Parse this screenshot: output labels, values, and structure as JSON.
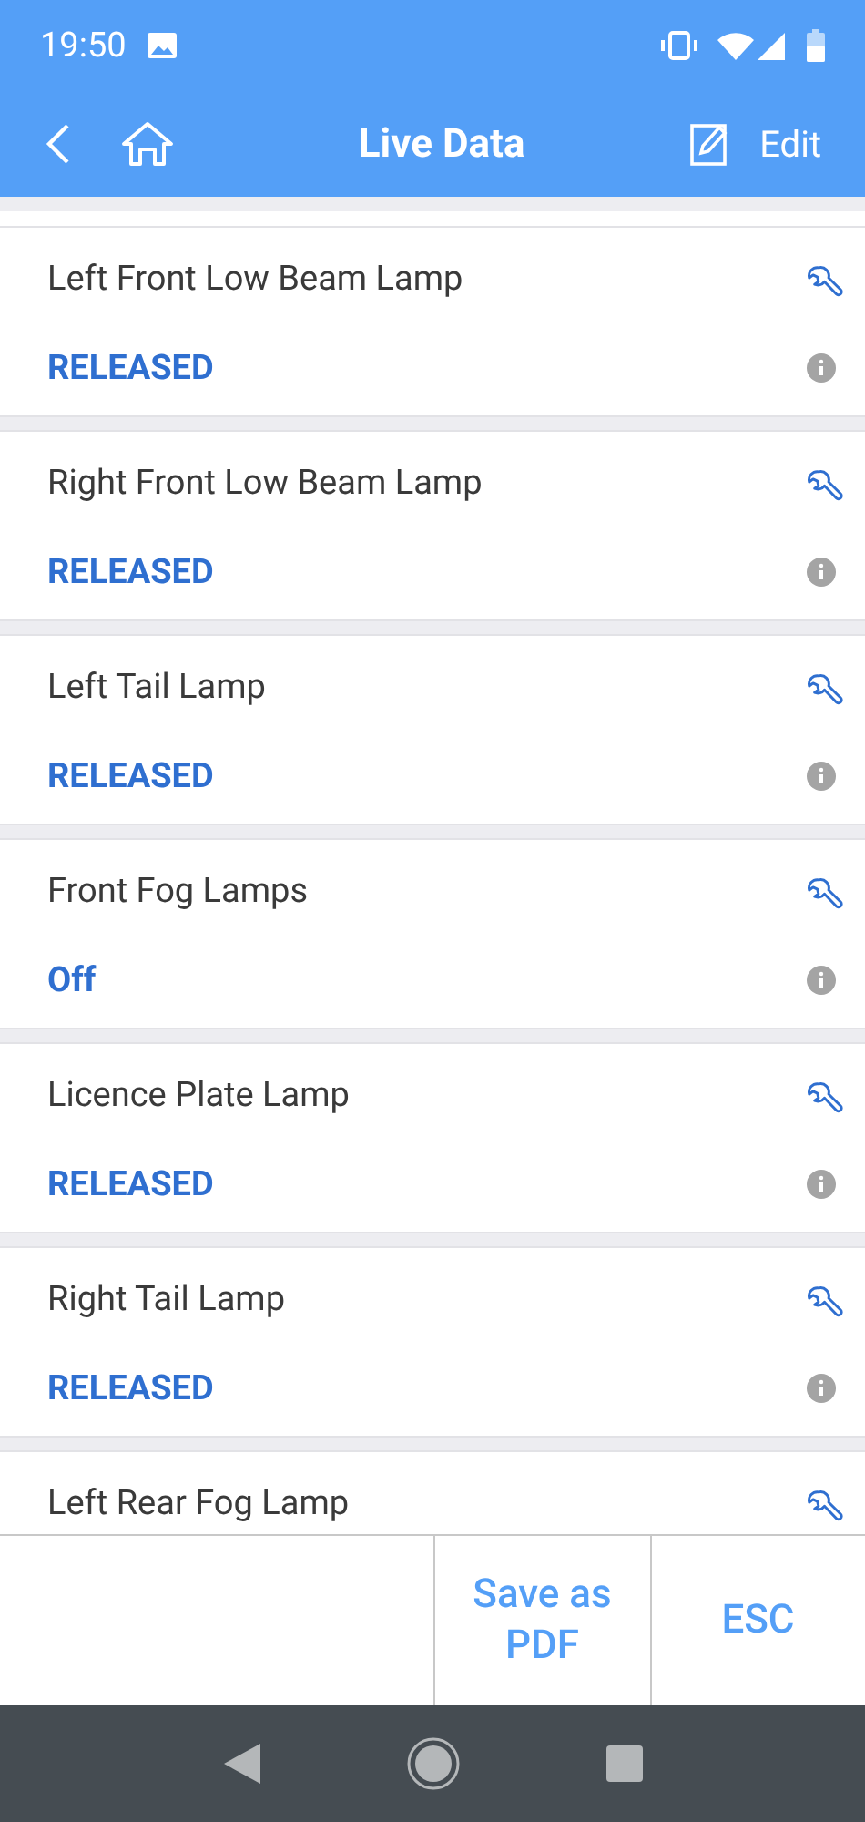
{
  "status_bar": {
    "time": "19:50"
  },
  "header": {
    "title": "Live Data",
    "edit_label": "Edit"
  },
  "items": [
    {
      "name": "Left Front Low Beam Lamp",
      "value": "RELEASED"
    },
    {
      "name": "Right Front Low Beam Lamp",
      "value": "RELEASED"
    },
    {
      "name": "Left Tail Lamp",
      "value": "RELEASED"
    },
    {
      "name": "Front Fog Lamps",
      "value": "Off"
    },
    {
      "name": "Licence Plate Lamp",
      "value": "RELEASED"
    },
    {
      "name": "Right Tail Lamp",
      "value": "RELEASED"
    },
    {
      "name": "Left Rear Fog Lamp"
    }
  ],
  "footer": {
    "buttons": [
      "Save as PDF",
      "ESC"
    ]
  }
}
